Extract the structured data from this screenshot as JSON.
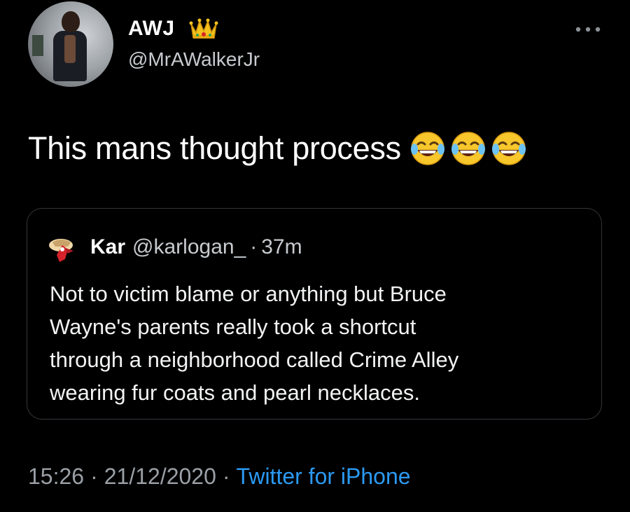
{
  "author": {
    "display_name": "AWJ",
    "badge_icon": "crown-emoji",
    "handle": "@MrAWalkerJr"
  },
  "menu": {
    "icon": "more-horizontal-icon"
  },
  "tweet": {
    "text": "This mans thought process",
    "emojis": [
      "face-with-tears-of-joy",
      "face-with-tears-of-joy",
      "face-with-tears-of-joy"
    ]
  },
  "quoted_tweet": {
    "name": "Kar",
    "handle": "@karlogan_",
    "separator": "·",
    "time": "37m",
    "lines": [
      "Not to victim blame or anything but Bruce",
      "Wayne's parents really took a shortcut",
      "through a neighborhood called Crime Alley",
      "wearing fur coats and pearl necklaces."
    ]
  },
  "meta": {
    "time": "15:26",
    "sep1": "·",
    "date": "21/12/2020",
    "sep2": "·",
    "source": "Twitter for iPhone"
  },
  "colors": {
    "background": "#000000",
    "secondary_text": "#9aa0a6",
    "link": "#2b9af3",
    "border": "#33373b"
  }
}
